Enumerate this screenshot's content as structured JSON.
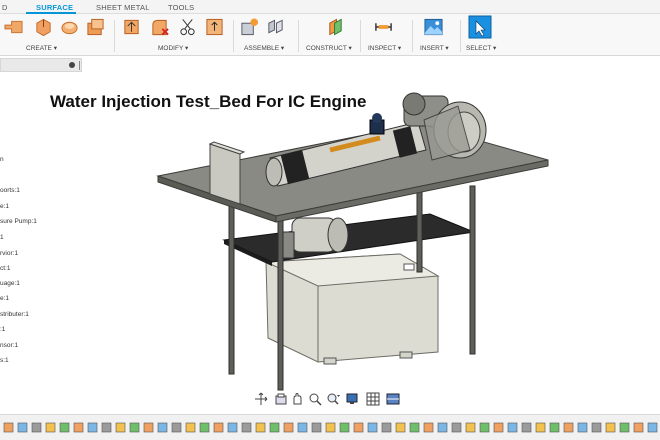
{
  "tabs": {
    "items": [
      {
        "label": "D"
      },
      {
        "label": "SURFACE",
        "active": true
      },
      {
        "label": "SHEET METAL"
      },
      {
        "label": "TOOLS"
      }
    ]
  },
  "ribbon": {
    "groups": [
      {
        "label": "CREATE ▾"
      },
      {
        "label": "MODIFY ▾"
      },
      {
        "label": "ASSEMBLE ▾"
      },
      {
        "label": "CONSTRUCT ▾"
      },
      {
        "label": "INSPECT ▾"
      },
      {
        "label": "INSERT ▾"
      },
      {
        "label": "SELECT ▾"
      }
    ]
  },
  "browser": {
    "items": [
      {
        "label": "n"
      },
      {
        "label": "oorts:1"
      },
      {
        "label": "e:1"
      },
      {
        "label": "sure Pump:1"
      },
      {
        "label": "1"
      },
      {
        "label": "rvior:1"
      },
      {
        "label": "ct:1"
      },
      {
        "label": "uage:1"
      },
      {
        "label": "e:1"
      },
      {
        "label": "stributer:1"
      },
      {
        "label": ":1"
      },
      {
        "label": "nsor:1"
      },
      {
        "label": "s:1"
      }
    ]
  },
  "canvas": {
    "title": "Water Injection Test_Bed For IC Engine"
  },
  "navbar": {
    "icons": [
      "orbit-icon",
      "look-at-icon",
      "pan-icon",
      "zoom-icon",
      "zoom-window-icon",
      "display-settings-icon",
      "grid-icon",
      "viewports-icon"
    ]
  },
  "colors": {
    "accent": "#0696d7",
    "table_top": "#8a8a84",
    "shelf": "#2b2b2b",
    "leg": "#5e5e5a",
    "tank": "#d9d9cf",
    "cylinder": "#cfcfc8"
  }
}
